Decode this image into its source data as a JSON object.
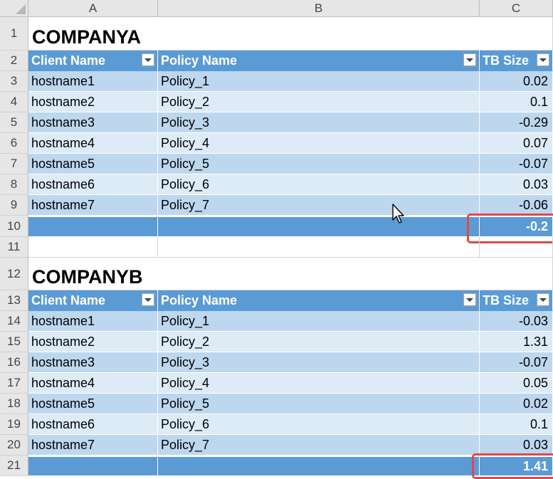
{
  "columns": [
    "A",
    "B",
    "C"
  ],
  "rows": [
    "1",
    "2",
    "3",
    "4",
    "5",
    "6",
    "7",
    "8",
    "9",
    "10",
    "11",
    "12",
    "13",
    "14",
    "15",
    "16",
    "17",
    "18",
    "19",
    "20",
    "21"
  ],
  "tables": [
    {
      "title": "COMPANYA",
      "headers": [
        "Client Name",
        "Policy Name",
        "TB Size"
      ],
      "data": [
        [
          "hostname1",
          "Policy_1",
          "0.02"
        ],
        [
          "hostname2",
          "Policy_2",
          "0.1"
        ],
        [
          "hostname3",
          "Policy_3",
          "-0.29"
        ],
        [
          "hostname4",
          "Policy_4",
          "0.07"
        ],
        [
          "hostname5",
          "Policy_5",
          "-0.07"
        ],
        [
          "hostname6",
          "Policy_6",
          "0.03"
        ],
        [
          "hostname7",
          "Policy_7",
          "-0.06"
        ]
      ],
      "total": "-0.2"
    },
    {
      "title": "COMPANYB",
      "headers": [
        "Client Name",
        "Policy Name",
        "TB Size"
      ],
      "data": [
        [
          "hostname1",
          "Policy_1",
          "-0.03"
        ],
        [
          "hostname2",
          "Policy_2",
          "1.31"
        ],
        [
          "hostname3",
          "Policy_3",
          "-0.07"
        ],
        [
          "hostname4",
          "Policy_4",
          "0.05"
        ],
        [
          "hostname5",
          "Policy_5",
          "0.02"
        ],
        [
          "hostname6",
          "Policy_6",
          "0.1"
        ],
        [
          "hostname7",
          "Policy_7",
          "0.03"
        ]
      ],
      "total": "1.41"
    }
  ],
  "colors": {
    "header_blue": "#5b9bd5",
    "band_dark": "#bdd7ee",
    "band_light": "#ddebf7",
    "highlight_red": "#e04848"
  },
  "icons": [
    "filter-dropdown-icon",
    "mouse-pointer-icon"
  ]
}
